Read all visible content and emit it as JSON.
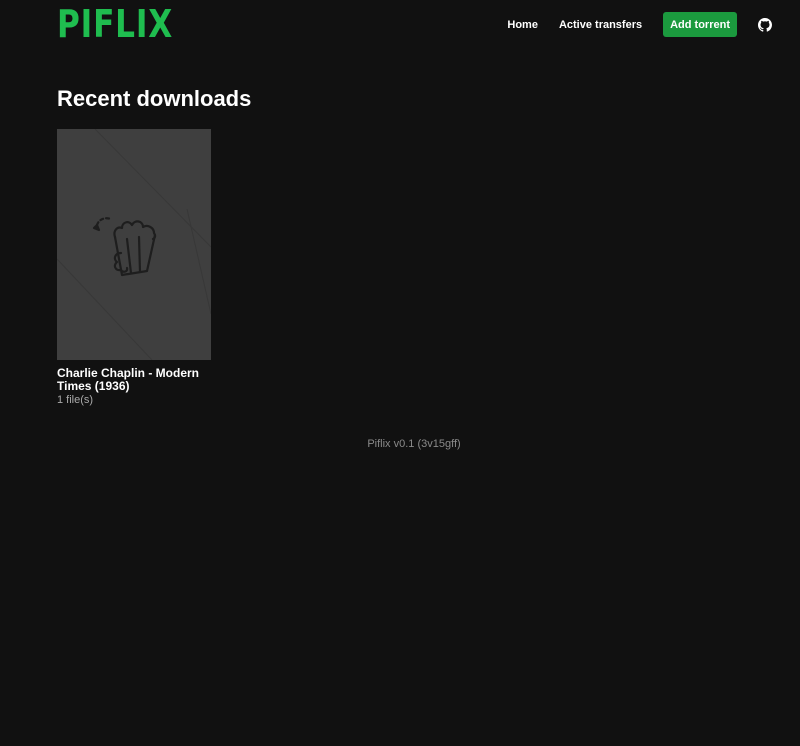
{
  "header": {
    "logo": "PIFLIX",
    "nav": {
      "home": "Home",
      "active_transfers": "Active transfers",
      "add_torrent": "Add torrent",
      "github_icon": "github-icon"
    }
  },
  "main": {
    "section_title": "Recent downloads",
    "downloads": [
      {
        "title": "Charlie Chaplin - Modern Times (1936)",
        "meta": "1 file(s)",
        "poster_icon": "popcorn-icon"
      }
    ]
  },
  "footer": {
    "version": "Piflix v0.1 (3v15gff)"
  },
  "colors": {
    "background": "#111111",
    "brand": "#1fbd4f",
    "button": "#1b9a3e",
    "poster": "#3f3f3f"
  }
}
